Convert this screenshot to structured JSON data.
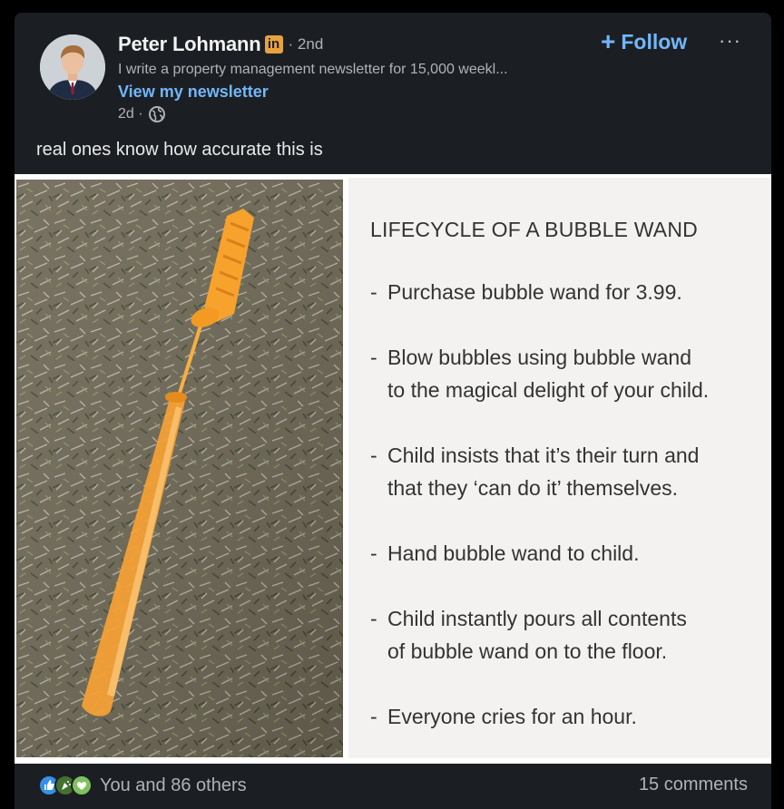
{
  "author": {
    "name": "Peter Lohmann",
    "badge": "in",
    "degree": "· 2nd",
    "headline": "I write a property management newsletter for 15,000 weekl...",
    "newsletter_link": "View my newsletter",
    "time": "2d ·"
  },
  "actions": {
    "follow_plus": "+",
    "follow_label": "Follow",
    "more": "···"
  },
  "post": {
    "text": "real ones know how accurate this is"
  },
  "meme": {
    "title": "LIFECYCLE OF A BUBBLE WAND",
    "items": [
      {
        "line1": "Purchase bubble wand for 3.99.",
        "line2": ""
      },
      {
        "line1": "Blow bubbles using bubble wand",
        "line2": "to the magical  delight of your child."
      },
      {
        "line1": "Child insists that it’s their turn and",
        "line2": "that they ‘can do it’ themselves."
      },
      {
        "line1": "Hand bubble wand to child.",
        "line2": ""
      },
      {
        "line1": "Child instantly pours all contents",
        "line2": "of bubble wand on to the floor."
      },
      {
        "line1": "Everyone cries for an hour.",
        "line2": ""
      }
    ]
  },
  "footer": {
    "reactions_text": "You and 86 others",
    "comments_text": "15 comments",
    "reaction_icons": [
      "like-icon",
      "celebrate-icon",
      "support-icon"
    ]
  },
  "colors": {
    "card_bg": "#1b1f23",
    "link_blue": "#71b7fb",
    "wand_orange": "#f5a030"
  }
}
